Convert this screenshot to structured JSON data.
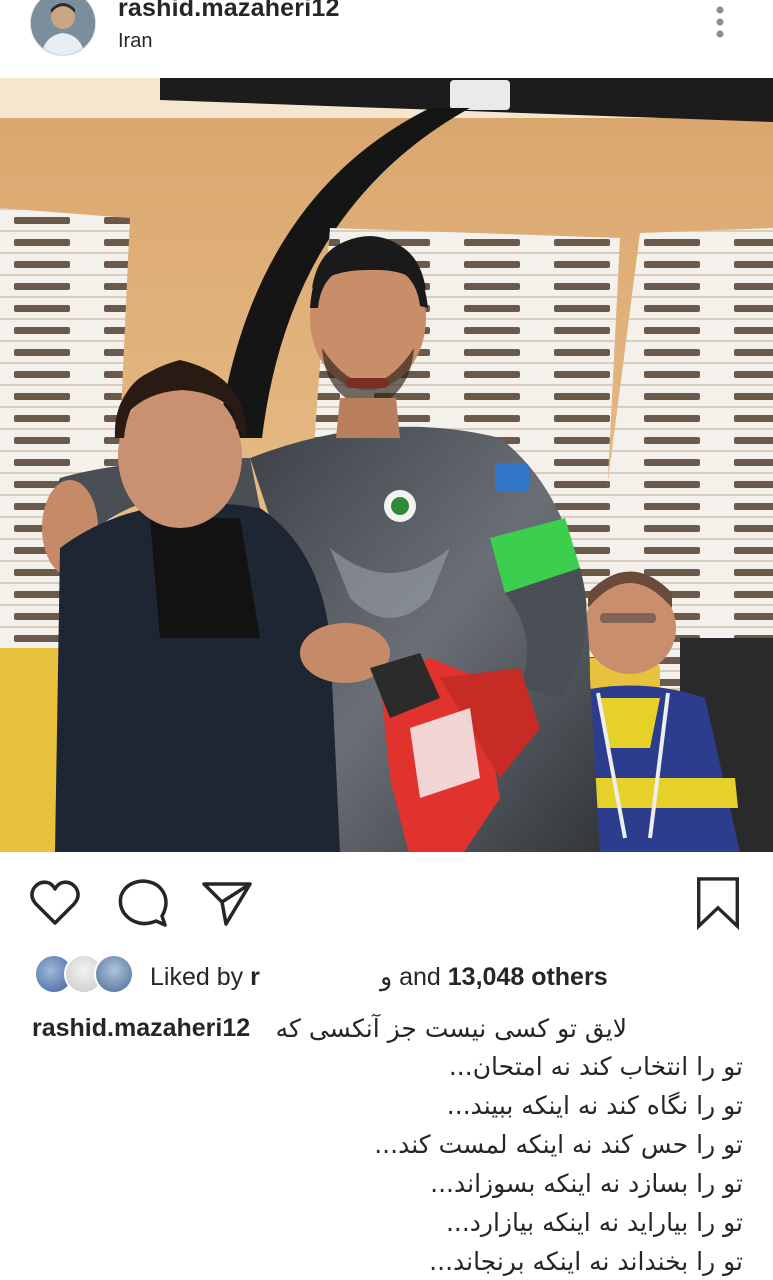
{
  "post": {
    "username": "rashid.mazaheri12",
    "location": "Iran"
  },
  "icons": {
    "more": "more-vertical-icon",
    "like": "heart-icon",
    "comment": "comment-icon",
    "share": "send-icon",
    "save": "bookmark-icon"
  },
  "likes": {
    "prefix": "Liked by",
    "user_fragment": "r",
    "user_suffix": "و",
    "conjunction": "and",
    "count_text": "13,048 others"
  },
  "caption": {
    "username": "rashid.mazaheri12",
    "first_line": "لایق تو کسی نیست جز آنکسی که",
    "lines": [
      "تو را انتخاب کند نه امتحان...",
      "تو را نگاه کند نه اینکه ببیند...",
      "تو را حس کند نه اینکه لمست کند...",
      "تو را بسازد نه اینکه بسوزاند...",
      "تو را بیاراید نه اینکه بیازارد...",
      "تو را بخنداند نه اینکه برنجاند..."
    ]
  },
  "colors": {
    "text": "#262626",
    "background": "#ffffff",
    "jersey": "#55595e",
    "armband": "#3ccf4e",
    "gloves": "#e0332d"
  }
}
